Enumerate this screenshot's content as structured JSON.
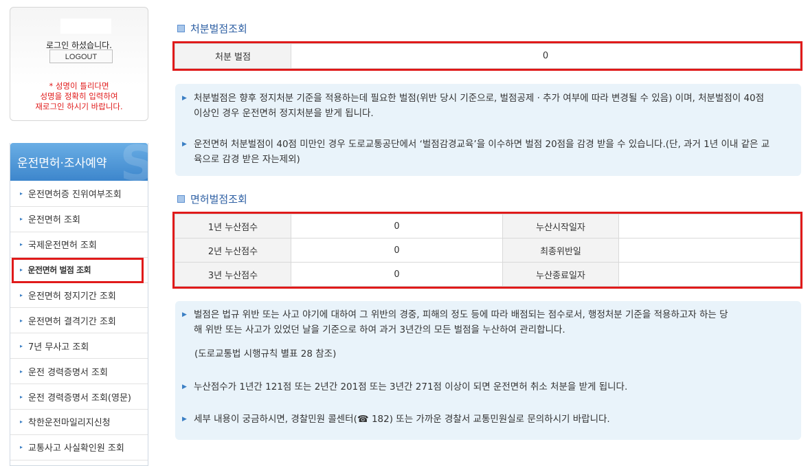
{
  "login": {
    "message": "로그인 하셨습니다.",
    "logout_label": "LOGOUT",
    "note": "* 성명이 틀리다면\n성명을 정확히 입력하여\n재로그인 하시기 바랍니다."
  },
  "menu": {
    "title": "운전면허·조사예약",
    "items": [
      {
        "label": "운전면허증 진위여부조회"
      },
      {
        "label": "운전면허 조회"
      },
      {
        "label": "국제운전면허 조회"
      },
      {
        "label": "운전면허 벌점 조회"
      },
      {
        "label": "운전면허 정지기간 조회"
      },
      {
        "label": "운전면허 결격기간 조회"
      },
      {
        "label": "7년 무사고 조회"
      },
      {
        "label": "운전 경력증명서 조회"
      },
      {
        "label": "운전 경력증명서 조회(영문)"
      },
      {
        "label": "착한운전마일리지신청"
      },
      {
        "label": "교통사고 사실확인원 조회"
      }
    ],
    "active_index": 3
  },
  "disposition": {
    "title": "처분벌점조회",
    "label": "처분 벌점",
    "value": "0"
  },
  "info1": {
    "p1": "처분벌점은 향후 정지처분 기준을 적용하는데 필요한 벌점(위반 당시 기준으로, 벌점공제 · 추가 여부에 따라 변경될 수 있음) 이며, 처분벌점이 40점 이상인 경우 운전면허 정지처분을 받게 됩니다.",
    "p2": "운전면허 처분벌점이 40점 미만인 경우 도로교통공단에서 ‘벌점감경교육’을 이수하면 벌점 20점을 감경 받을 수 있습니다.(단, 과거 1년 이내 같은 교육으로 감경 받은 자는제외)"
  },
  "license": {
    "title": "면허벌점조회",
    "rows": [
      {
        "label": "1년 누산점수",
        "value": "0",
        "label2": "누산시작일자",
        "value2": ""
      },
      {
        "label": "2년 누산점수",
        "value": "0",
        "label2": "최종위반일",
        "value2": ""
      },
      {
        "label": "3년 누산점수",
        "value": "0",
        "label2": "누산종료일자",
        "value2": ""
      }
    ]
  },
  "info2": {
    "p1": "벌점은 법규 위반 또는 사고 야기에 대하여 그 위반의 경중, 피해의 정도 등에 따라 배점되는 점수로서, 행정처분 기준을 적용하고자 하는 당해 위반 또는 사고가 있었던 날을 기준으로 하여 과거 3년간의 모든 벌점을 누산하여 관리합니다.",
    "ref": "(도로교통법 시행규칙 별표 28 참조)",
    "p2": "누산점수가 1년간 121점 또는 2년간 201점 또는 3년간 271점 이상이 되면 운전면허 취소 처분을 받게 됩니다.",
    "p3": "세부 내용이 궁금하시면, 경찰민원 콜센터(☎ 182) 또는 가까운 경찰서 교통민원실로 문의하시기 바랍니다."
  }
}
